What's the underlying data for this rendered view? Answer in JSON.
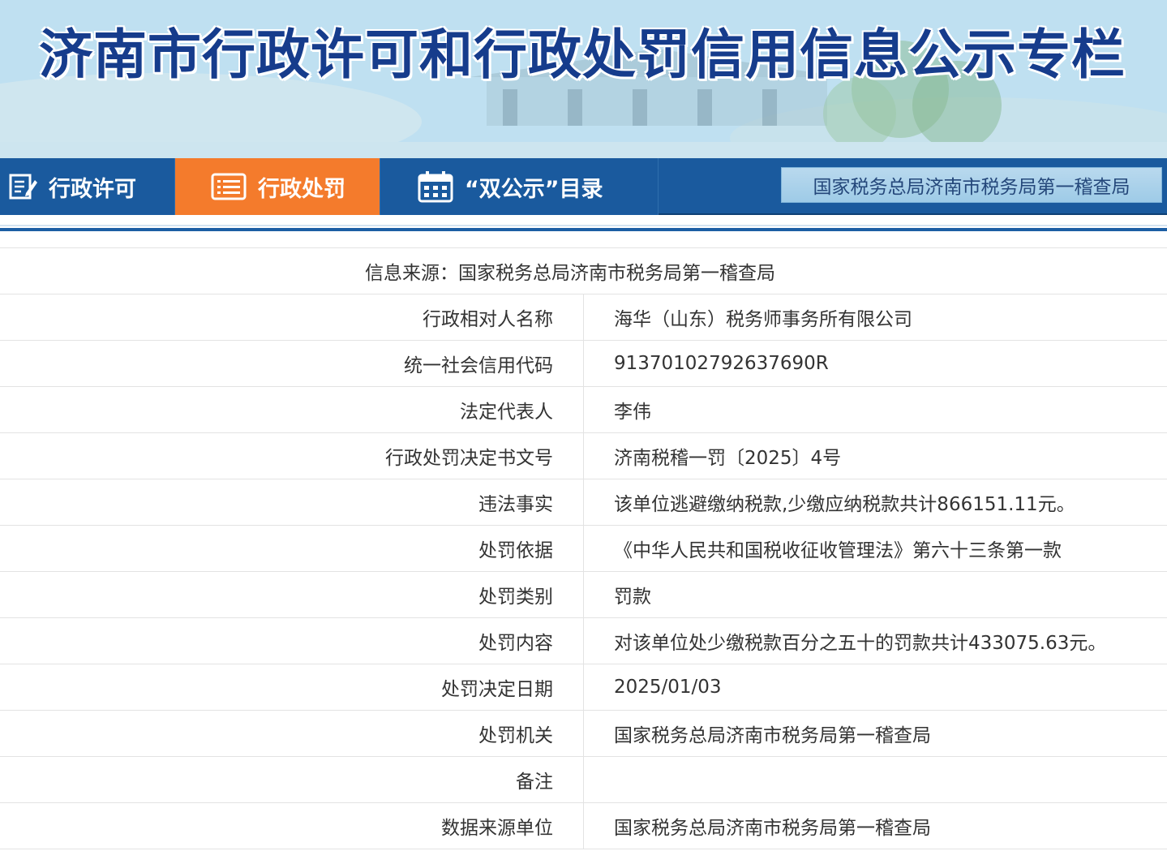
{
  "banner": {
    "title": "济南市行政许可和行政处罚信用信息公示专栏"
  },
  "nav": {
    "tabs": [
      {
        "label": "行政许可",
        "icon": "edit-document-icon",
        "active": false
      },
      {
        "label": "行政处罚",
        "icon": "list-icon",
        "active": true
      },
      {
        "label": "“双公示”目录",
        "icon": "calendar-icon",
        "active": false
      }
    ],
    "agency": "国家税务总局济南市税务局第一稽查局",
    "active_color": "#f47b2c",
    "nav_color": "#1a5a9e"
  },
  "record": {
    "source_line": "信息来源：国家税务总局济南市税务局第一稽查局",
    "rows": [
      {
        "label": "行政相对人名称",
        "value": "海华（山东）税务师事务所有限公司"
      },
      {
        "label": "统一社会信用代码",
        "value": "91370102792637690R"
      },
      {
        "label": "法定代表人",
        "value": "李伟"
      },
      {
        "label": "行政处罚决定书文号",
        "value": "济南税稽一罚〔2025〕4号"
      },
      {
        "label": "违法事实",
        "value": "该单位逃避缴纳税款,少缴应纳税款共计866151.11元。"
      },
      {
        "label": "处罚依据",
        "value": "《中华人民共和国税收征收管理法》第六十三条第一款"
      },
      {
        "label": "处罚类别",
        "value": "罚款"
      },
      {
        "label": "处罚内容",
        "value": "对该单位处少缴税款百分之五十的罚款共计433075.63元。"
      },
      {
        "label": "处罚决定日期",
        "value": "2025/01/03"
      },
      {
        "label": "处罚机关",
        "value": "国家税务总局济南市税务局第一稽查局"
      },
      {
        "label": "备注",
        "value": ""
      },
      {
        "label": "数据来源单位",
        "value": "国家税务总局济南市税务局第一稽查局"
      }
    ]
  }
}
